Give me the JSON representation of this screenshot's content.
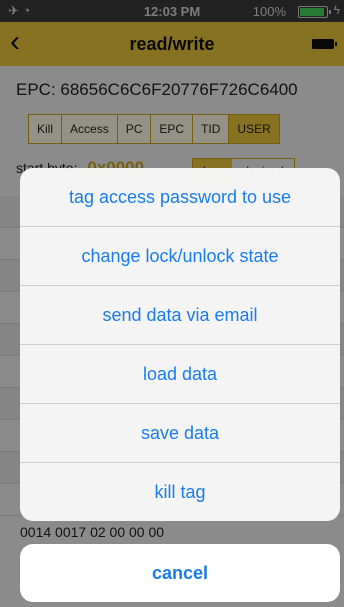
{
  "status_bar": {
    "time": "12:03 PM",
    "battery_pct": "100%",
    "battery_fill": 1.0,
    "icons": [
      "airplane-icon",
      "wifi-icon",
      "battery-icon",
      "charging-icon"
    ]
  },
  "nav": {
    "title": "read/write",
    "back_icon": "chevron-left-icon",
    "device_battery_icon": "battery-icon"
  },
  "main": {
    "epc_line": "EPC: 68656C6C6F20776F726C6400",
    "tabs": [
      "Kill",
      "Access",
      "PC",
      "EPC",
      "TID",
      "USER"
    ],
    "active_tab": "USER",
    "start_byte_label": "start byte:",
    "start_byte_value": "0x0000",
    "format_options": [
      "hex",
      "decimal"
    ],
    "active_format": "hex",
    "bottom_row_text": "0014 0017        02           00          00        00"
  },
  "action_sheet": {
    "items": [
      "tag access password to use",
      "change lock/unlock state",
      "send data via email",
      "load data",
      "save data",
      "kill tag"
    ],
    "cancel": "cancel"
  },
  "colors": {
    "accent_yellow": "#e8c43a",
    "ios_blue": "#1a7cf0",
    "status_bar": "#3a3a3a"
  }
}
